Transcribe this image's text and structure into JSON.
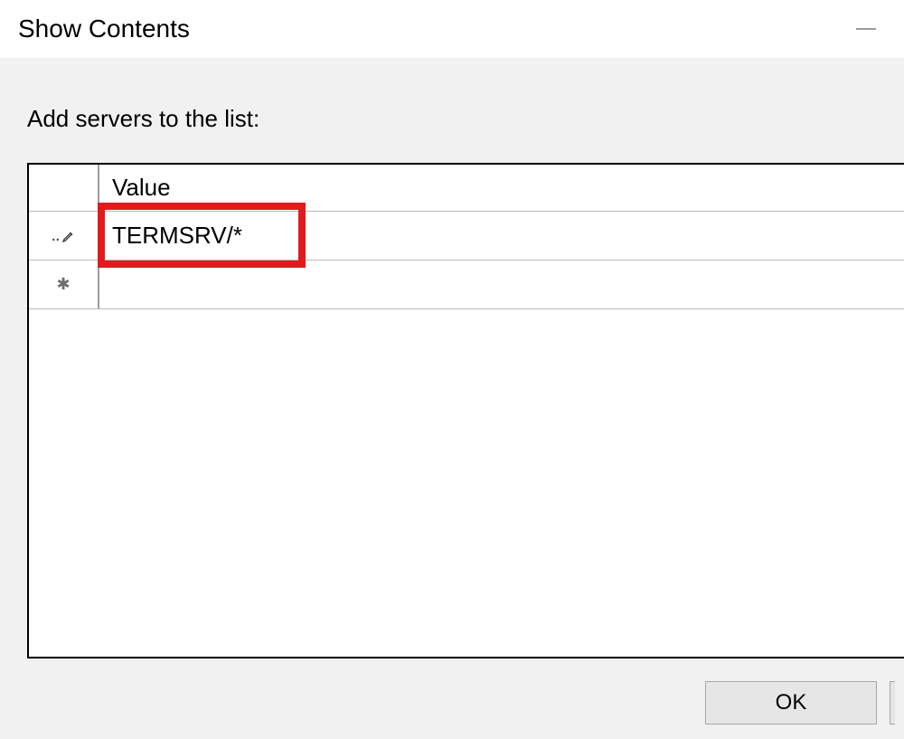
{
  "window": {
    "title": "Show Contents"
  },
  "prompt_label": "Add servers to the list:",
  "grid": {
    "column_header": "Value",
    "rows": [
      {
        "marker": "edit",
        "value": "TERMSRV/*"
      },
      {
        "marker": "new",
        "value": ""
      }
    ]
  },
  "buttons": {
    "ok": "OK"
  },
  "annotation": {
    "highlight_row_index": 0
  }
}
